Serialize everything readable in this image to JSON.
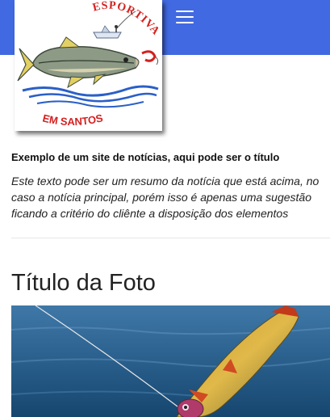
{
  "logo": {
    "text_top": "ESPORTIVA",
    "text_bottom": "EM SANTOS"
  },
  "header": {
    "menu_icon": "hamburger-menu-icon",
    "bar_color": "#4169e1"
  },
  "news": {
    "headline": "Exemplo de um site de notícias, aqui pode ser o título",
    "summary": "Este texto pode ser um resumo da notícia que está acima, no caso a notícia principal, porém isso é apenas uma sugestão ficando a critério do cliênte a disposição dos elementos"
  },
  "photo_section": {
    "title": "Título da Foto"
  }
}
